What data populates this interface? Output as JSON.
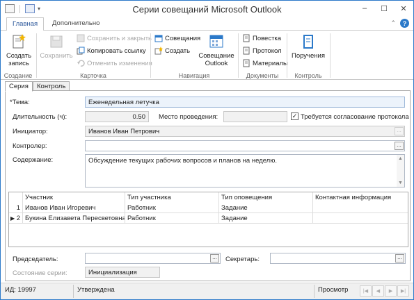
{
  "window": {
    "title": "Серии совещаний Microsoft Outlook"
  },
  "ribbon": {
    "tabs": [
      "Главная",
      "Дополнительно"
    ],
    "groups": {
      "create": {
        "label": "Создание",
        "new_record": "Создать\nзапись"
      },
      "card": {
        "label": "Карточка",
        "save": "Сохранить",
        "save_close": "Сохранить и закрыть",
        "copy_link": "Копировать ссылку",
        "undo": "Отменить изменения"
      },
      "navigation": {
        "label": "Навигация",
        "meetings": "Совещания",
        "create": "Создать",
        "outlook_meeting": "Совещание\nOutlook"
      },
      "documents": {
        "label": "Документы",
        "agenda": "Повестка",
        "protocol": "Протокол",
        "materials": "Материалы"
      },
      "control": {
        "label": "Контроль",
        "assignments": "Поручения"
      }
    }
  },
  "form_tabs": [
    "Серия",
    "Контроль"
  ],
  "form": {
    "topic_label": "*Тема:",
    "topic_value": "Еженедельная летучка",
    "duration_label": "Длительность (ч):",
    "duration_value": "0.50",
    "place_label": "Место проведения:",
    "place_value": "",
    "protocol_required_label": "Требуется согласование протокола",
    "protocol_required": true,
    "initiator_label": "Инициатор:",
    "initiator_value": "Иванов Иван Петрович",
    "controller_label": "Контролер:",
    "controller_value": "",
    "content_label": "Содержание:",
    "content_value": "Обсуждение текущих рабочих вопросов и планов на неделю.",
    "chairman_label": "Председатель:",
    "chairman_value": "",
    "secretary_label": "Секретарь:",
    "secretary_value": "",
    "state_label": "Состояние серии:",
    "state_value": "Инициализация"
  },
  "participants": {
    "columns": [
      "Участник",
      "Тип участника",
      "Тип оповещения",
      "Контактная информация"
    ],
    "rows": [
      {
        "num": "1",
        "participant": "Иванов Иван Игоревич",
        "type": "Работник",
        "notify": "Задание",
        "contact": ""
      },
      {
        "num": "2",
        "participant": "Букина Елизавета Пересветовна ...",
        "type": "Работник",
        "notify": "Задание",
        "contact": ""
      }
    ]
  },
  "status_bar": {
    "id": "ИД: 19997",
    "state": "Утверждена",
    "mode": "Просмотр"
  },
  "colors": {
    "accent": "#2b79c9",
    "ribbon_text": "#2b579a"
  }
}
